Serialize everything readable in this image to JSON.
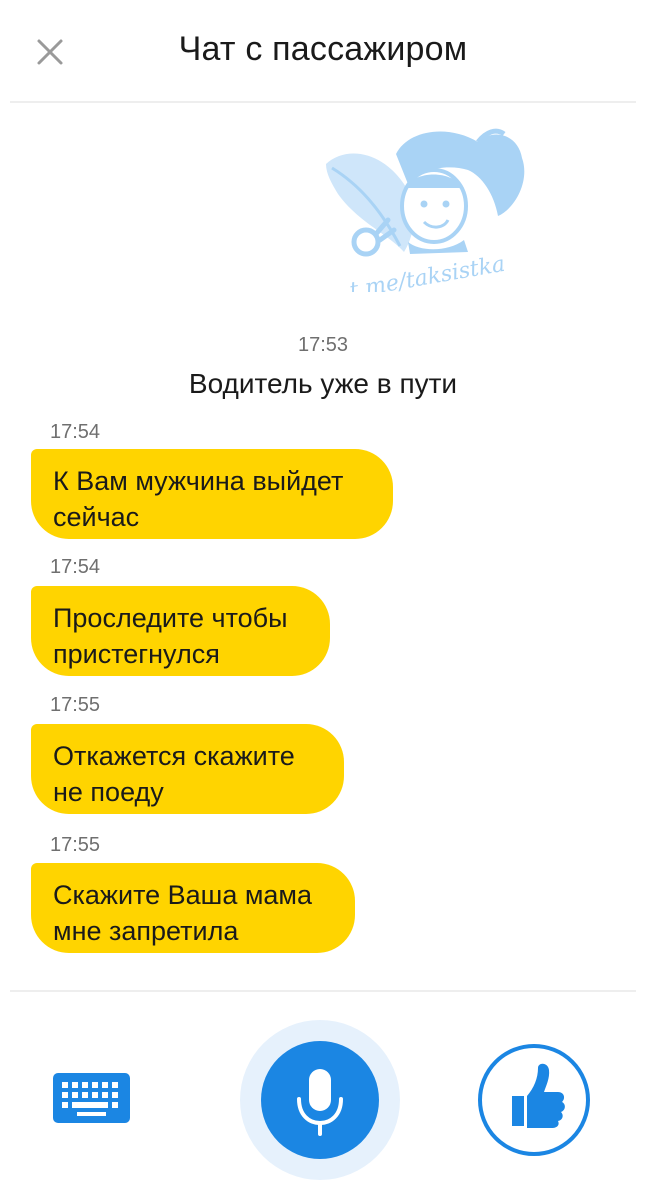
{
  "header": {
    "title": "Чат с пассажиром",
    "close_icon": "close-icon"
  },
  "watermark": {
    "text": "t.me/taksistka",
    "icon": "taxi-girl-logo",
    "color": "#a9d3f5"
  },
  "chat": {
    "system": {
      "time": "17:53",
      "text": "Водитель уже в пути"
    },
    "messages": [
      {
        "time": "17:54",
        "lines": [
          "К Вам мужчина выйдет",
          "сейчас"
        ]
      },
      {
        "time": "17:54",
        "lines": [
          "Проследите чтобы",
          "пристегнулся"
        ]
      },
      {
        "time": "17:55",
        "lines": [
          "Откажется скажите",
          "не поеду"
        ]
      },
      {
        "time": "17:55",
        "lines": [
          "Скажите Ваша мама",
          "мне запретила"
        ]
      }
    ]
  },
  "footer": {
    "keyboard_icon": "keyboard-icon",
    "mic_icon": "microphone-icon",
    "like_icon": "thumbs-up-icon"
  },
  "colors": {
    "bubble": "#ffd400",
    "accent": "#1b86e3",
    "halo": "#e6f1fc"
  }
}
